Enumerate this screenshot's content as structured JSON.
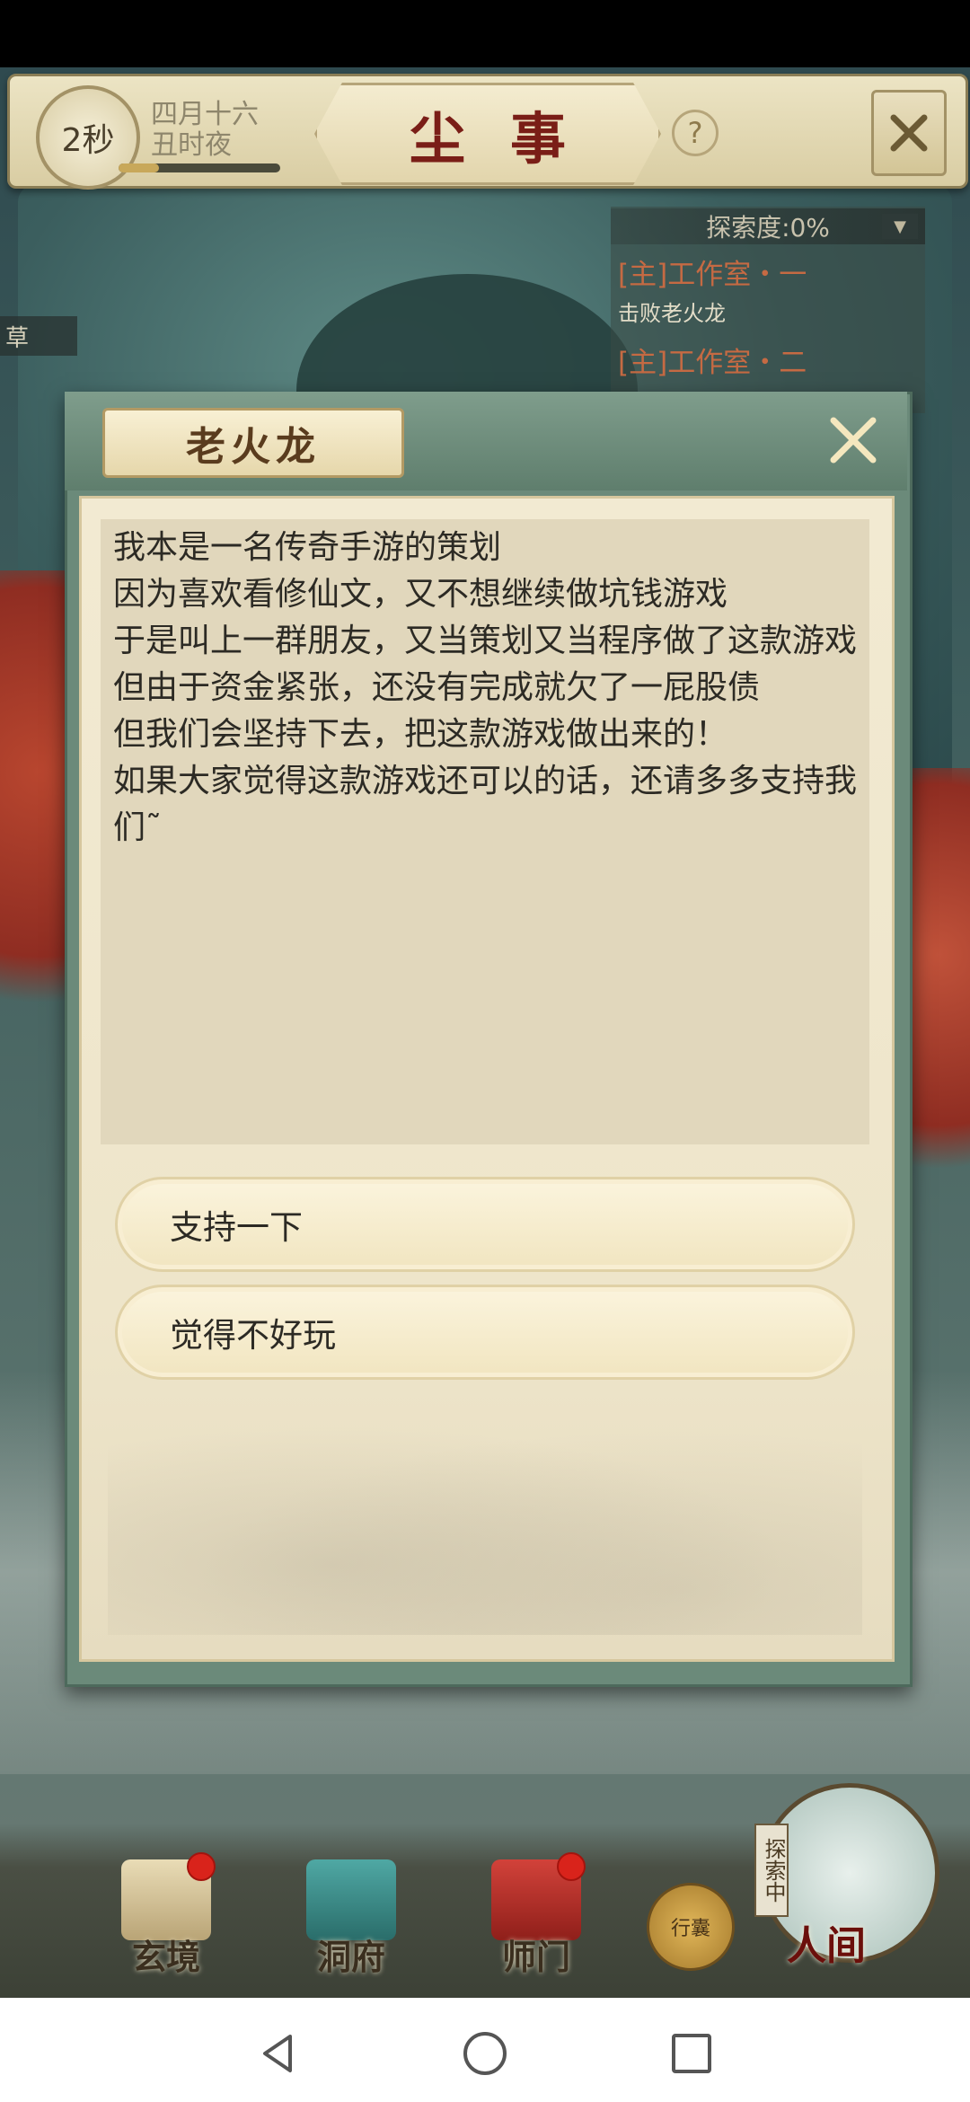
{
  "top_bar": {
    "timer": "2秒",
    "date_line1": "四月十六",
    "date_line2": "丑时夜",
    "time_progress": 0.25,
    "title": "尘事",
    "help": "?"
  },
  "quest_panel": {
    "header": "探索度:0%",
    "items": [
      {
        "title": "[主]工作室・一",
        "desc": "击败老火龙"
      },
      {
        "title": "[主]工作室・二",
        "desc": ""
      }
    ],
    "left_label": "草"
  },
  "dialog": {
    "npc_name": "老火龙",
    "lines": [
      "我本是一名传奇手游的策划",
      "因为喜欢看修仙文，又不想继续做坑钱游戏",
      "于是叫上一群朋友，又当策划又当程序做了这款游戏",
      "但由于资金紧张，还没有完成就欠了一屁股债",
      "但我们会坚持下去，把这款游戏做出来的！",
      "如果大家觉得这款游戏还可以的话，还请多多支持我们˜"
    ],
    "options": [
      {
        "label": "支持一下"
      },
      {
        "label": "觉得不好玩"
      }
    ]
  },
  "bottom_nav": {
    "items": [
      {
        "label": "玄境",
        "badge": true
      },
      {
        "label": "洞府",
        "badge": false
      },
      {
        "label": "师门",
        "badge": true
      }
    ],
    "bag_label": "行囊",
    "explore_tag": "探索中",
    "world_label": "人间"
  }
}
